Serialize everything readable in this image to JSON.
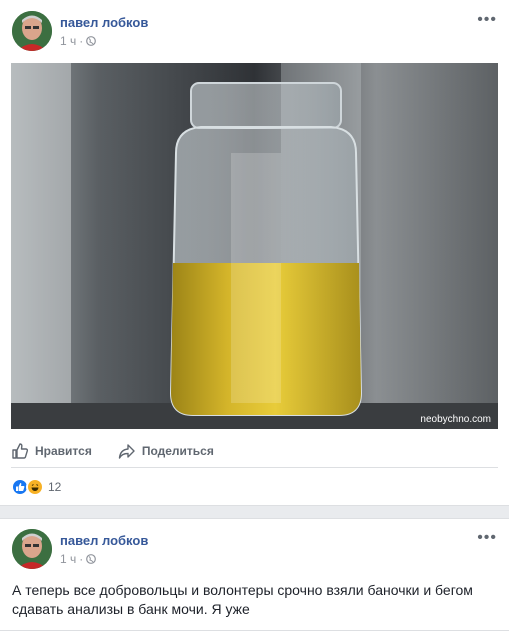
{
  "post1": {
    "author": "павел лобков",
    "time": "1 ч",
    "separator": "·",
    "more": "•••",
    "photo_watermark": "neobychno.com",
    "actions": {
      "like": "Нравится",
      "share": "Поделиться"
    },
    "reaction_count": "12"
  },
  "post2": {
    "author": "павел лобков",
    "time": "1 ч",
    "separator": "·",
    "more": "•••",
    "text": "А теперь все добровольцы и волонтеры срочно взяли баночки и бегом сдавать анализы в банк мочи. Я уже"
  },
  "colors": {
    "link": "#365899",
    "muted": "#90949c",
    "like_blue": "#1877f2"
  }
}
